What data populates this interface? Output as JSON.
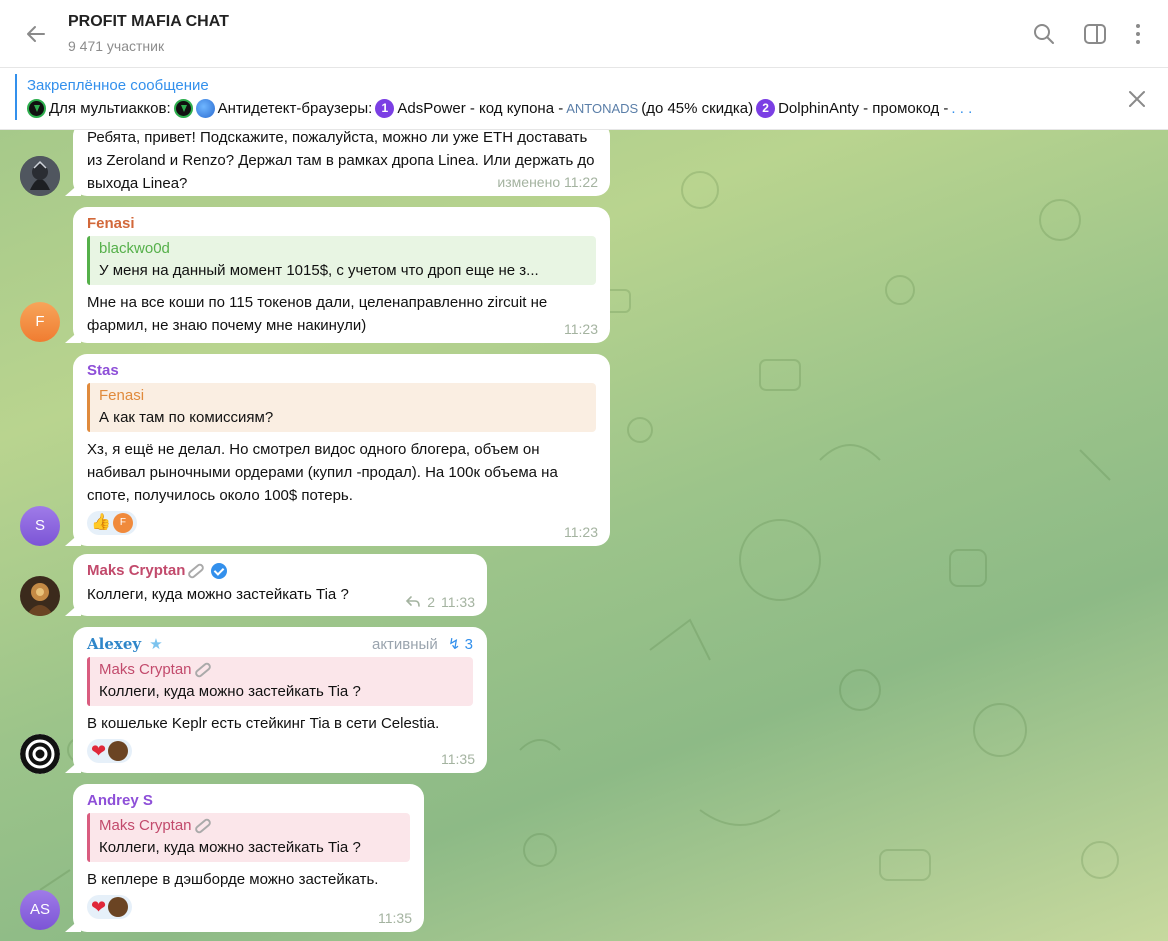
{
  "header": {
    "title": "PROFIT MAFIA CHAT",
    "subtitle": "9 471 участник"
  },
  "pinned": {
    "label": "Закреплённое сообщение",
    "part1": "Для мультиакков:",
    "part2": "Антидетект-браузеры:",
    "part3": "AdsPower - код купона -",
    "code": "ANTONADS",
    "part4": "(до 45% скидка)",
    "part5": "DolphinAnty - промокод -",
    "ellipsis": ". . .",
    "num1": "1",
    "num2": "2"
  },
  "messages": [
    {
      "text": "Ребята, привет! Подскажите, пожалуйста, можно ли уже ETH доставать из Zeroland и Renzo? Держал там в рамках дропа Linea. Или держать до выхода Linea?",
      "time": "изменено 11:22"
    },
    {
      "sender": "Fenasi",
      "avatar": "F",
      "quote_name": "blackwo0d",
      "quote_text": "У меня на данный момент 1015$, с учетом что дроп еще не з...",
      "text": "Мне на все коши по 115 токенов дали, целенаправленно zircuit не фармил, не знаю почему мне накинули)",
      "time": "11:23"
    },
    {
      "sender": "Stas",
      "avatar": "S",
      "quote_name": "Fenasi",
      "quote_text": "А как там по комиссиям?",
      "text": "Хз, я ещё не делал. Но смотрел видос одного блогера, объем он набивал рыночными ордерами (купил -продал). На 100к объема на споте, получилось около 100$ потерь.",
      "reaction_avatar": "F",
      "time": "11:23"
    },
    {
      "sender": "Maks Cryptan",
      "text": "Коллеги, куда можно застейкать Tia ?",
      "replies": "2",
      "time": "11:33"
    },
    {
      "sender": "Alexey",
      "rank": "активный",
      "rank_count": "3",
      "quote_name": "Maks Cryptan",
      "quote_text": "Коллеги, куда можно застейкать Tia ?",
      "text": "В кошельке Keplr есть стейкинг Tia в сети Celestia.",
      "time": "11:35"
    },
    {
      "sender": "Andrey S",
      "avatar": "AS",
      "quote_name": "Maks Cryptan",
      "quote_text": "Коллеги, куда можно застейкать Tia ?",
      "text": "В кеплере в дэшборде можно застейкать.",
      "time": "11:35"
    }
  ],
  "colors": {
    "accent": "#3390ec",
    "fenasi": "#d2683a",
    "stas": "#8e4fd8",
    "maks": "#c24a6c",
    "alexey": "#2f86c9",
    "andrey": "#8e4fd8",
    "blackwo0d": "#55b04a"
  }
}
